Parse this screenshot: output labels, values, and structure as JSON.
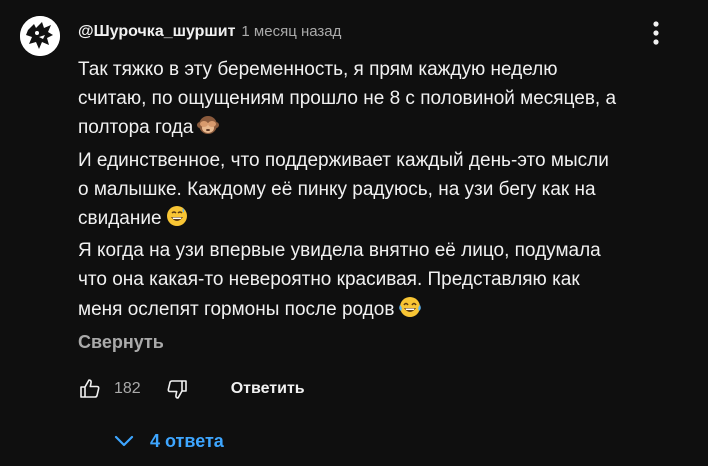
{
  "comment": {
    "author": "@Шурочка_шуршит",
    "timestamp": "1 месяц назад",
    "lines": [
      "Так тяжко в эту беременность, я прям каждую неделю",
      "считаю, по ощущениям прошло не 8 с половиной месяцев, а",
      "полтора года",
      "И единственное, что поддерживает каждый день-это мысли",
      "о малышке. Каждому её пинку радуюсь, на узи бегу как на",
      "свидание",
      "Я когда на узи впервые увидела внятно её лицо, подумала",
      "что она какая-то невероятно красивая. Представляю как",
      "меня ослепят гормоны после родов"
    ],
    "emojis": {
      "line3": "see-no-evil-monkey-emoji",
      "line6": "grinning-face-with-sweat-emoji",
      "line9": "face-with-tears-of-joy-emoji"
    },
    "collapse_label": "Свернуть",
    "like_count": "182",
    "reply_label": "Ответить",
    "replies_label": "4 ответа"
  },
  "icons": {
    "more": "more-vert-icon",
    "like": "thumb-up-icon",
    "dislike": "thumb-down-icon",
    "expand": "chevron-down-icon"
  },
  "colors": {
    "background": "#0f0f0f",
    "text": "#f1f1f1",
    "secondary_text": "#aaaaaa",
    "link": "#3ea6ff"
  }
}
